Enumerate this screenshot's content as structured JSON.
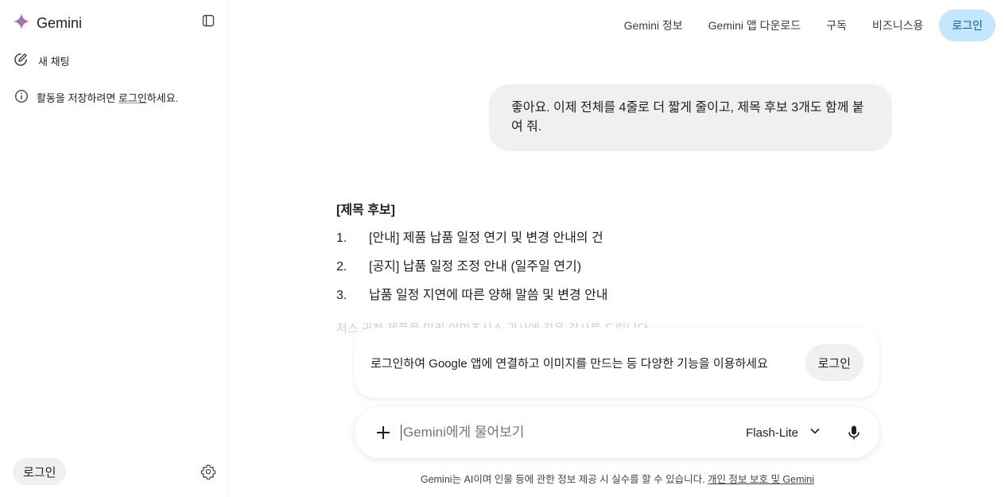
{
  "sidebar": {
    "brand": "Gemini",
    "new_chat": "새 채팅",
    "notice_prefix": "활동을 저장하려면 ",
    "notice_link": "로그인",
    "notice_suffix": "하세요.",
    "login": "로그인"
  },
  "topnav": {
    "items": [
      "Gemini 정보",
      "Gemini 앱 다운로드",
      "구독",
      "비즈니스용"
    ],
    "login": "로그인"
  },
  "chat": {
    "user_message": "좋아요. 이제 전체를 4줄로 더 짧게 줄이고, 제목 후보 3개도 함께 붙여 줘.",
    "answer_heading": "[제목 후보]",
    "answer_items": [
      {
        "num": "1.",
        "text": "[안내] 제품 납품 일정 연기 및 변경 안내의 건"
      },
      {
        "num": "2.",
        "text": "[공지] 납품 일정 조정 안내 (일주일 연기)"
      },
      {
        "num": "3.",
        "text": "납품 일정 지연에 따른 양해 말씀 및 변경 안내"
      }
    ],
    "faded_text": "저스 귀하 제품을 미리 이미즈시스 귀사에 깊은 감사를 드립니다"
  },
  "login_card": {
    "text": "로그인하여 Google 앱에 연결하고 이미지를 만드는 등 다양한 기능을 이용하세요",
    "button": "로그인"
  },
  "input": {
    "placeholder": "Gemini에게 물어보기",
    "model": "Flash-Lite"
  },
  "disclaimer": {
    "text": "Gemini는 AI이며 인물 등에 관한 정보 제공 시 실수를 할 수 있습니다. ",
    "link": "개인 정보 보호 및 Gemini"
  },
  "colors": {
    "accent_button_bg": "#c2e7ff",
    "accent_button_text": "#0b57d0",
    "bubble_bg": "#f0f0f0"
  },
  "icons": [
    "gemini-sparkle-icon",
    "sidebar-toggle-icon",
    "edit-icon",
    "info-icon",
    "gear-icon",
    "plus-icon",
    "chevron-down-icon",
    "mic-icon"
  ]
}
